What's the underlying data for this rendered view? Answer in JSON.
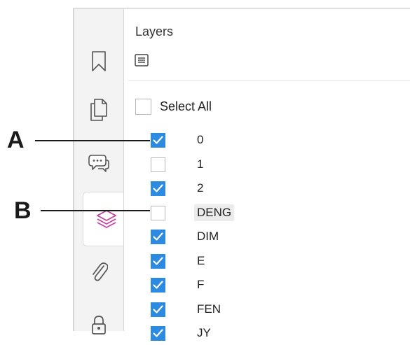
{
  "panel": {
    "title": "Layers",
    "options_icon": "list-options-icon",
    "select_all_label": "Select All",
    "select_all_checked": false
  },
  "rail": {
    "items": [
      {
        "name": "bookmark",
        "icon": "bookmark-icon",
        "active": false
      },
      {
        "name": "pages",
        "icon": "pages-icon",
        "active": false
      },
      {
        "name": "comments",
        "icon": "comment-icon",
        "active": false
      },
      {
        "name": "layers",
        "icon": "layers-icon",
        "active": true
      },
      {
        "name": "attachments",
        "icon": "paperclip-icon",
        "active": false
      },
      {
        "name": "security",
        "icon": "lock-icon",
        "active": false
      }
    ]
  },
  "layers": [
    {
      "name": "0",
      "checked": true,
      "highlighted": false
    },
    {
      "name": "1",
      "checked": false,
      "highlighted": false
    },
    {
      "name": "2",
      "checked": true,
      "highlighted": false
    },
    {
      "name": "DENG",
      "checked": false,
      "highlighted": true
    },
    {
      "name": "DIM",
      "checked": true,
      "highlighted": false
    },
    {
      "name": "E",
      "checked": true,
      "highlighted": false
    },
    {
      "name": "F",
      "checked": true,
      "highlighted": false
    },
    {
      "name": "FEN",
      "checked": true,
      "highlighted": false
    },
    {
      "name": "JY",
      "checked": true,
      "highlighted": false
    }
  ],
  "callouts": {
    "a": "A",
    "b": "B"
  },
  "colors": {
    "accent": "#2c8be0",
    "active_icon": "#c2459e",
    "icon": "#555555"
  }
}
